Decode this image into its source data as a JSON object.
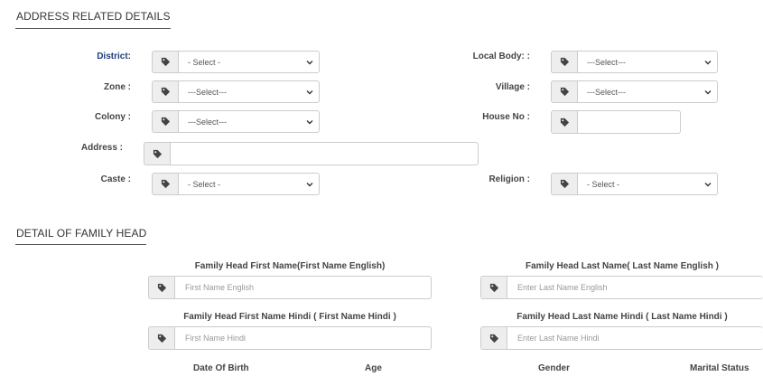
{
  "address_section": {
    "title": "ADDRESS RELATED DETAILS",
    "district_label": "District:",
    "district_value": "- Select -",
    "local_body_label": "Local Body: :",
    "local_body_value": "---Select---",
    "zone_label": "Zone :",
    "zone_value": "---Select---",
    "village_label": "Village :",
    "village_value": "---Select---",
    "colony_label": "Colony :",
    "colony_value": "---Select---",
    "house_no_label": "House No :",
    "house_no_value": "",
    "address_label": "Address :",
    "address_value": "",
    "caste_label": "Caste :",
    "caste_value": "- Select -",
    "religion_label": "Religion :",
    "religion_value": "- Select -"
  },
  "family_section": {
    "title": "DETAIL OF FAMILY HEAD",
    "first_name_en_label": "Family Head First Name(First Name English)",
    "first_name_en_placeholder": "First Name English",
    "last_name_en_label": "Family Head Last Name( Last Name English )",
    "last_name_en_placeholder": "Enter  Last Name English",
    "first_name_hi_label": "Family Head First Name Hindi ( First Name Hindi )",
    "first_name_hi_placeholder": "First Name Hindi",
    "last_name_hi_label": "Family Head Last Name Hindi ( Last Name Hindi )",
    "last_name_hi_placeholder": "Enter  Last Name Hindi",
    "dob_label": "Date Of Birth",
    "age_label": "Age",
    "gender_label": "Gender",
    "marital_label": "Marital Status"
  },
  "colors": {
    "label_blue": "#1f3d7a",
    "border": "#cccccc",
    "addon_bg": "#eeeeee"
  }
}
